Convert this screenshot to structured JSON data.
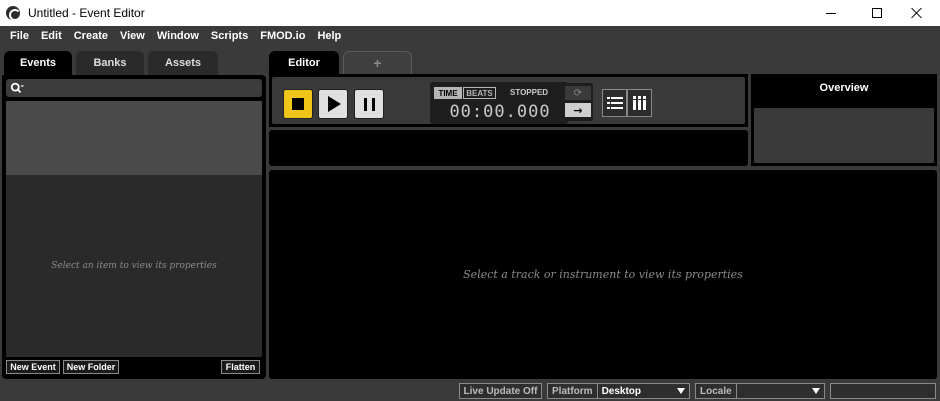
{
  "window": {
    "title": "Untitled - Event Editor",
    "app_icon": "fmod-logo-icon"
  },
  "menu": [
    "File",
    "Edit",
    "Create",
    "View",
    "Window",
    "Scripts",
    "FMOD.io",
    "Help"
  ],
  "left_tabs": [
    "Events",
    "Banks",
    "Assets"
  ],
  "left_panel": {
    "search_placeholder": "",
    "properties_placeholder": "Select an item to view its properties",
    "buttons": {
      "new_event": "New Event",
      "new_folder": "New Folder",
      "flatten": "Flatten"
    }
  },
  "editor_tabs": {
    "active": "Editor",
    "add": "+"
  },
  "transport": {
    "time_mode": "TIME",
    "beats_mode": "BEATS",
    "state": "STOPPED",
    "time": "00:00.000",
    "follow_glyph": "→",
    "loop_glyph": "⟳"
  },
  "overview": {
    "title": "Overview"
  },
  "main": {
    "placeholder": "Select a track or instrument to view its properties"
  },
  "statusbar": {
    "live_update": "Live Update Off",
    "platform_label": "Platform",
    "platform_value": "Desktop",
    "locale_label": "Locale",
    "locale_value": ""
  },
  "colors": {
    "accent_stop": "#f0c419",
    "background": "#3a3a3a",
    "panel": "#000000"
  }
}
